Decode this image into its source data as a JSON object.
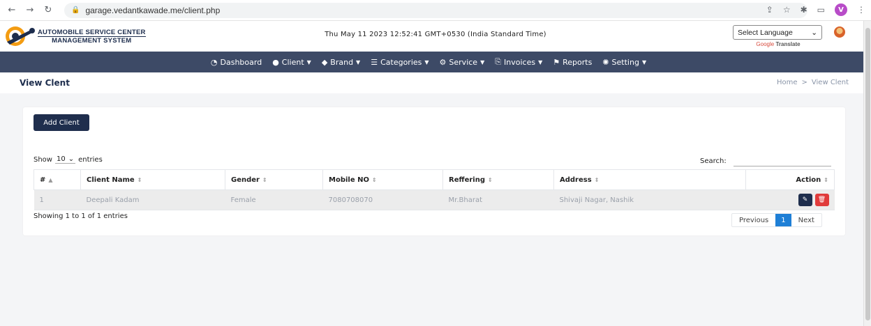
{
  "browser": {
    "url": "garage.vedantkawade.me/client.php",
    "profile_initial": "V"
  },
  "header": {
    "logo_line1": "AUTOMOBILE SERVICE CENTER",
    "logo_line2": "MANAGEMENT SYSTEM",
    "datetime": "Thu May 11 2023 12:52:41 GMT+0530 (India Standard Time)",
    "language_select": "Select Language",
    "powered_by_google": "Google",
    "powered_by_translate": "Translate"
  },
  "nav": {
    "items": [
      {
        "label": "Dashboard",
        "icon": "dashboard-icon"
      },
      {
        "label": "Client",
        "icon": "user-icon"
      },
      {
        "label": "Brand",
        "icon": "tag-icon"
      },
      {
        "label": "Categories",
        "icon": "list-icon"
      },
      {
        "label": "Service",
        "icon": "cogs-icon"
      },
      {
        "label": "Invoices",
        "icon": "invoice-icon"
      },
      {
        "label": "Reports",
        "icon": "flag-icon"
      },
      {
        "label": "Setting",
        "icon": "gear-icon"
      }
    ]
  },
  "page": {
    "title": "View Clent",
    "breadcrumb_home": "Home",
    "breadcrumb_sep": ">",
    "breadcrumb_current": "View Clent"
  },
  "card": {
    "add_button": "Add Client",
    "show_label": "Show",
    "entries_value": "10",
    "entries_label": "entries",
    "search_label": "Search:",
    "info": "Showing 1 to 1 of 1 entries",
    "previous": "Previous",
    "current_page": "1",
    "next": "Next"
  },
  "table": {
    "headers": [
      "#",
      "Client Name",
      "Gender",
      "Mobile NO",
      "Reffering",
      "Address",
      "Action"
    ],
    "rows": [
      [
        "1",
        "Deepali Kadam",
        "Female",
        "7080708070",
        "Mr.Bharat",
        "Shivaji Nagar, Nashik"
      ]
    ]
  }
}
